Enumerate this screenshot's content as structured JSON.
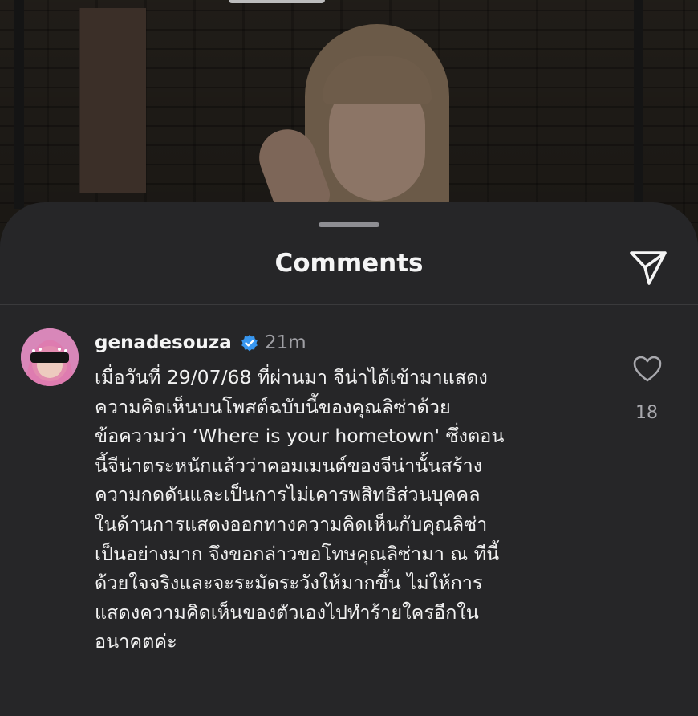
{
  "sheet": {
    "title": "Comments"
  },
  "icons": {
    "share": "paper-plane-icon",
    "verified": "verified-badge-icon",
    "like": "heart-icon"
  },
  "colors": {
    "background": "#262628",
    "text": "#f5f5f5",
    "muted": "#a0a0a5",
    "verified": "#3897f0"
  },
  "comment": {
    "username": "genadesouza",
    "time": "21m",
    "lines": [
      "เมื่อวันที่ 29/07/68 ที่ผ่านมา จีน่าได้เข้ามาแสดง",
      "ความคิดเห็นบนโพสต์ฉบับนี้ของคุณลิซ่าด้วย",
      "ข้อความว่า ‘Where is your hometown' ซึ่งตอน",
      "นี้จีน่าตระหนักแล้วว่าคอมเมนต์ของจีน่านั้นสร้าง",
      "ความกดดันและเป็นการไม่เคารพสิทธิส่วนบุคคล",
      "ในด้านการแสดงออกทางความคิดเห็นกับคุณลิซ่า",
      "เป็นอย่างมาก จึงขอกล่าวขอโทษคุณลิซ่ามา ณ ทีนี้",
      "ด้วยใจจริงและจะระมัดระวังให้มากขึ้น ไม่ให้การ",
      "แสดงความคิดเห็นของตัวเองไปทำร้ายใครอีกใน",
      "อนาคตค่ะ"
    ],
    "likes": "18"
  }
}
